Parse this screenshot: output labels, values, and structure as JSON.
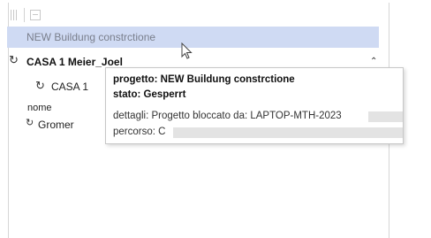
{
  "tree": {
    "project_label": "NEW Buildung constrctione",
    "group_label": "CASA 1 Meier_Joel",
    "sub_label": "CASA 1",
    "field_name": "nome",
    "field_value": "Gromer"
  },
  "tooltip": {
    "project_line": "progetto: NEW Buildung  constrctione",
    "status_line": "stato: Gesperrt",
    "details_line": "dettagli: Progetto bloccato da: LAPTOP-MTH-2023",
    "path_line": "percorso: C"
  },
  "icons": {
    "toolbar_grid": "columns-icon",
    "toolbar_exit": "exit-icon",
    "refresh": "refresh-icon",
    "collapse": "chevron-up-icon",
    "cursor": "mouse-pointer-icon"
  },
  "colors": {
    "selection": "#cfdaf3",
    "redaction": "#e3e3e3"
  }
}
